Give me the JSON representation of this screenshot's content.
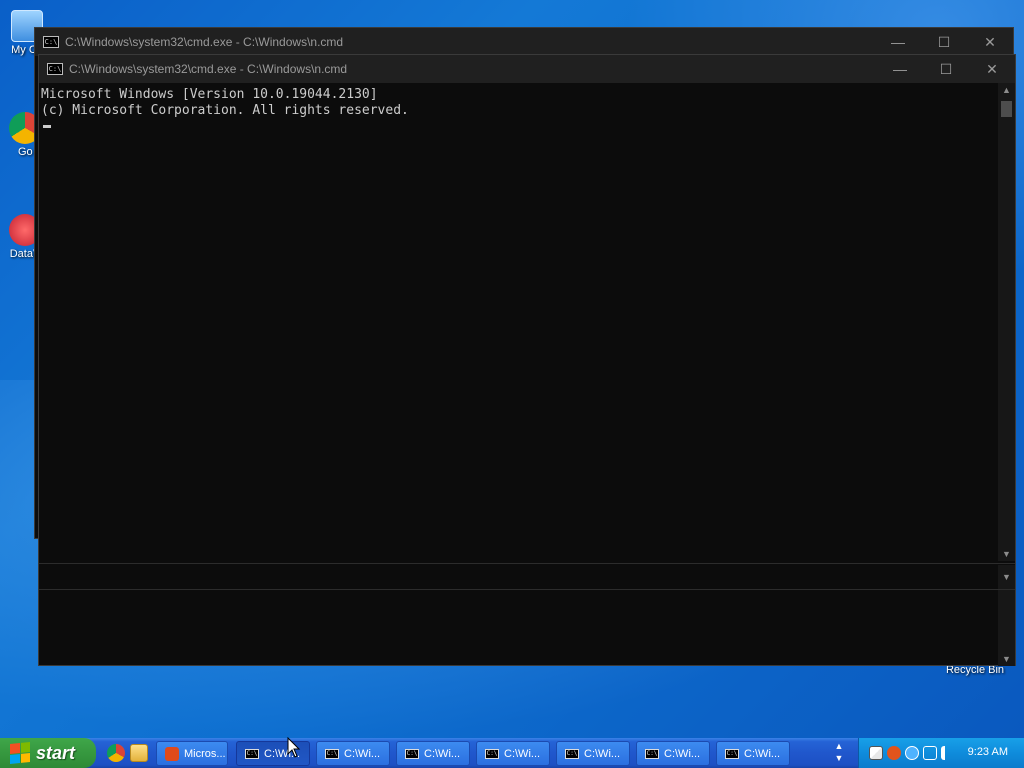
{
  "desktop": {
    "icons": [
      {
        "label": "My Co",
        "icon": "my-computer-icon"
      },
      {
        "label": "Go Ch",
        "icon": "chrome-icon"
      },
      {
        "label": "DataV",
        "icon": "datav-icon"
      },
      {
        "label": "Recycle Bin",
        "icon": "recycle-bin-icon"
      }
    ]
  },
  "windows": {
    "back": {
      "title": "C:\\Windows\\system32\\cmd.exe - C:\\Windows\\n.cmd",
      "icon_text": "C:\\"
    },
    "front": {
      "title": "C:\\Windows\\system32\\cmd.exe - C:\\Windows\\n.cmd",
      "icon_text": "C:\\",
      "console_lines": [
        "Microsoft Windows [Version 10.0.19044.2130]",
        "(c) Microsoft Corporation. All rights reserved."
      ]
    },
    "controls": {
      "minimize": "—",
      "maximize": "☐",
      "close": "✕"
    }
  },
  "taskbar": {
    "start_label": "start",
    "quick_launch": [
      "chrome-icon",
      "folder-icon"
    ],
    "items": [
      {
        "label": "Micros...",
        "icon": "office-icon",
        "active": false
      },
      {
        "label": "C:\\Wi...",
        "icon": "cmd-icon",
        "active": true
      },
      {
        "label": "C:\\Wi...",
        "icon": "cmd-icon",
        "active": false
      },
      {
        "label": "C:\\Wi...",
        "icon": "cmd-icon",
        "active": false
      },
      {
        "label": "C:\\Wi...",
        "icon": "cmd-icon",
        "active": false
      },
      {
        "label": "C:\\Wi...",
        "icon": "cmd-icon",
        "active": false
      },
      {
        "label": "C:\\Wi...",
        "icon": "cmd-icon",
        "active": false
      },
      {
        "label": "C:\\Wi...",
        "icon": "cmd-icon",
        "active": false
      }
    ],
    "clock": "9:23 AM"
  },
  "colors": {
    "console_bg": "#0c0c0c",
    "console_text": "#cccccc",
    "taskbar_blue": "#2057cc",
    "start_green": "#389b41"
  }
}
